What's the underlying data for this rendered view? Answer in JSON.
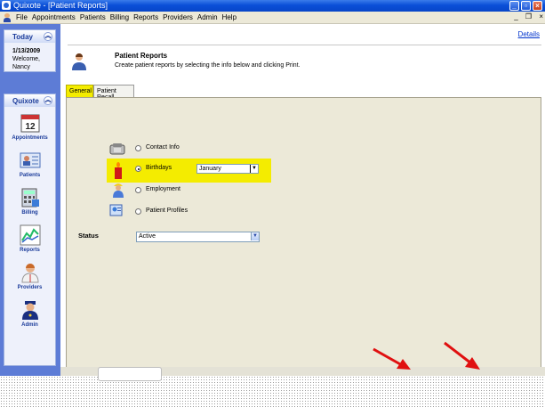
{
  "window": {
    "title": "Quixote - [Patient Reports]"
  },
  "menu": {
    "items": [
      "File",
      "Appointments",
      "Patients",
      "Billing",
      "Reports",
      "Providers",
      "Admin",
      "Help"
    ]
  },
  "sidebar": {
    "today": {
      "title": "Today",
      "date": "1/13/2009",
      "welcome": "Welcome,",
      "user": "Nancy"
    },
    "quixote": {
      "title": "Quixote",
      "items": [
        {
          "label": "Appointments",
          "icon": "calendar-icon"
        },
        {
          "label": "Patients",
          "icon": "patient-card-icon"
        },
        {
          "label": "Billing",
          "icon": "calculator-icon"
        },
        {
          "label": "Reports",
          "icon": "chart-icon"
        },
        {
          "label": "Providers",
          "icon": "doctor-icon"
        },
        {
          "label": "Admin",
          "icon": "officer-icon"
        }
      ]
    }
  },
  "main": {
    "details_link": "Details",
    "header": {
      "title": "Patient Reports",
      "description": "Create patient reports by selecting the info below and clicking Print."
    },
    "tabs": [
      {
        "label": "General",
        "active": true
      },
      {
        "label": "Patient Recall",
        "active": false
      }
    ],
    "options": [
      {
        "label": "Contact Info",
        "selected": false,
        "icon": "phone-icon"
      },
      {
        "label": "Birthdays",
        "selected": true,
        "icon": "birthday-candle-icon"
      },
      {
        "label": "Employment",
        "selected": false,
        "icon": "worker-icon"
      },
      {
        "label": "Patient Profiles",
        "selected": false,
        "icon": "profile-icon"
      }
    ],
    "month_select": {
      "value": "January"
    },
    "status": {
      "label": "Status",
      "value": "Active"
    }
  },
  "colors": {
    "highlight": "#f4ec00",
    "sidebar": "#5d7cd6",
    "titlebar": "#0a4fd8",
    "arrow": "#e01010"
  }
}
